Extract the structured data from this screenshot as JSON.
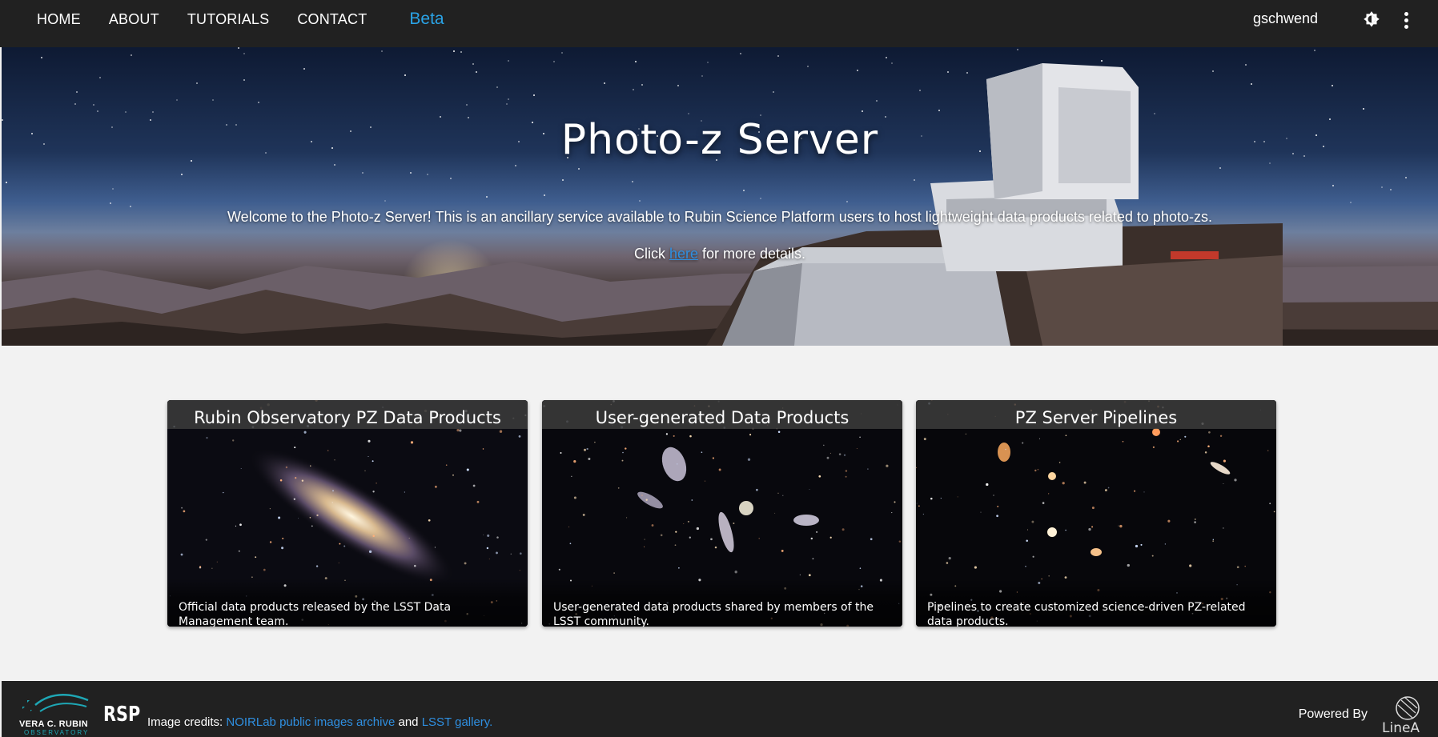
{
  "nav": {
    "items": [
      "HOME",
      "ABOUT",
      "TUTORIALS",
      "CONTACT"
    ],
    "beta": "Beta",
    "username": "gschwend",
    "theme_icon": "brightness-icon",
    "menu_icon": "more-vert-icon"
  },
  "hero": {
    "title": "Photo-z Server",
    "welcome": "Welcome to the Photo-z Server! This is an ancillary service available to Rubin Science Platform users to host lightweight data products related to photo-zs.",
    "click_prefix": "Click ",
    "click_link": "here",
    "click_suffix": " for more details."
  },
  "cards": [
    {
      "title": "Rubin Observatory PZ Data Products",
      "description": "Official data products released by the LSST Data Management team."
    },
    {
      "title": "User-generated Data Products",
      "description": "User-generated data products shared by members of the LSST community."
    },
    {
      "title": "PZ Server Pipelines",
      "description": "Pipelines to create customized science-driven PZ-related data products."
    }
  ],
  "footer": {
    "rubin_name": "VERA C. RUBIN",
    "rubin_sub": "OBSERVATORY",
    "rsp": "RSP",
    "credits_prefix": "Image credits: ",
    "credits_link1": "NOIRLab public images archive",
    "credits_and": " and ",
    "credits_link2": "LSST gallery.",
    "powered_by": "Powered By",
    "linea": "LineA"
  },
  "colors": {
    "topbar": "#212121",
    "beta": "#2aa3e6",
    "link": "#2f8fe0",
    "page_bg": "#f2f2f2"
  }
}
